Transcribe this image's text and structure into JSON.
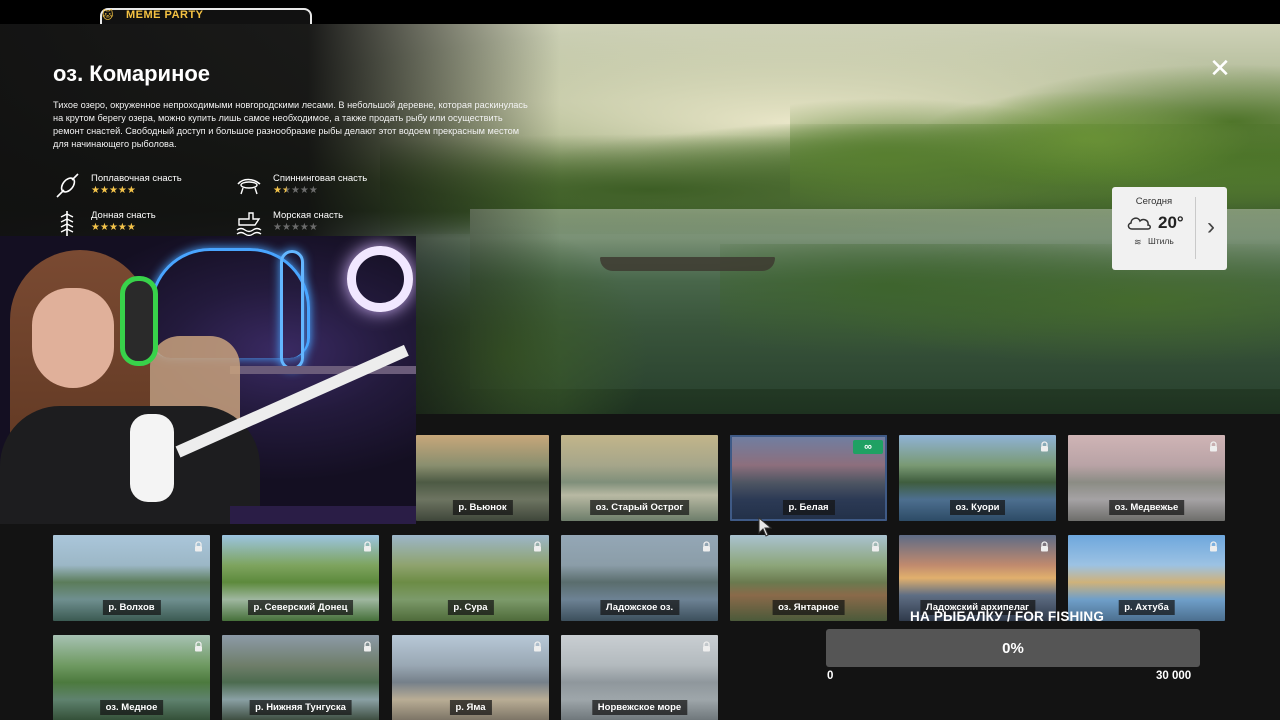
{
  "stream": {
    "badge_text": "MEME PARTY"
  },
  "lake": {
    "title": "оз. Комариное",
    "description": "Тихое озеро, окруженное непроходимыми новгородскими лесами. В небольшой деревне, которая раскинулась на крутом берегу озера, можно купить лишь самое необходимое, а также продать рыбу или осуществить ремонт снастей. Свободный доступ и большое разнообразие рыбы делают этот водоем прекрасным местом для начинающего рыболова.",
    "tackle": [
      {
        "label": "Поплавочная снасть",
        "icon": "float-rod-icon",
        "rating": 5,
        "max": 5
      },
      {
        "label": "Спиннинговая снасть",
        "icon": "spinning-rod-icon",
        "rating": 1.5,
        "max": 5
      },
      {
        "label": "Донная снасть",
        "icon": "bottom-rod-icon",
        "rating": 5,
        "max": 5
      },
      {
        "label": "Морская снасть",
        "icon": "sea-rod-icon",
        "rating": 0,
        "max": 5
      }
    ]
  },
  "weather": {
    "day": "Сегодня",
    "icon": "cloud-icon",
    "temperature": "20°",
    "wind": "Штиль",
    "wind_icon": "wind-icon",
    "next_icon": "chevron-right-icon"
  },
  "close_icon": "close-icon",
  "locations": [
    {
      "name": "р. Вьюнок",
      "locked": false,
      "bg": "linear-gradient(180deg,#c7a77a 0%,#8a8f6f 35%,#4d5a44 55%,#6d7461 75%,#3f463a 100%)"
    },
    {
      "name": "оз. Старый Острог",
      "locked": false,
      "bg": "linear-gradient(180deg,#c2b58a 0%,#a6a68a 35%,#7f8f7a 55%,#b8b9a3 70%,#6d7d6a 100%)"
    },
    {
      "name": "р. Белая",
      "locked": false,
      "badge": "∞",
      "active": true,
      "bg": "linear-gradient(180deg,#6e7fa3 0%,#8d6f7d 35%,#4f5663 55%,#2c3a55 75%,#223048 100%)"
    },
    {
      "name": "оз. Куори",
      "locked": true,
      "bg": "linear-gradient(180deg,#8fb2d6 0%,#7a9a74 35%,#3f5d3e 55%,#4d6f8f 75%,#2d4b66 100%)"
    },
    {
      "name": "оз. Медвежье",
      "locked": true,
      "bg": "linear-gradient(180deg,#cfb4b5 0%,#b9a3a6 35%,#8b8c84 55%,#a5a2a4 75%,#6d6d6a 100%)"
    },
    {
      "name": "р. Волхов",
      "locked": true,
      "bg": "linear-gradient(180deg,#aac6da 0%,#9cb7c6 35%,#5b7c5a 55%,#6f8f8f 75%,#3b5a52 100%)"
    },
    {
      "name": "р. Северский Донец",
      "locked": true,
      "bg": "linear-gradient(180deg,#9cc4e1 0%,#7ea45f 35%,#5d8a3c 55%,#9fb7a0 75%,#46703a 100%)"
    },
    {
      "name": "р. Сура",
      "locked": true,
      "bg": "linear-gradient(180deg,#9cb6c9 0%,#8fa36e 35%,#6c8c45 55%,#7c9a6a 75%,#4f6b3a 100%)"
    },
    {
      "name": "Ладожское оз.",
      "locked": true,
      "bg": "linear-gradient(180deg,#94a7b6 0%,#8b9da8 35%,#5a6d6d 55%,#6d8294 75%,#3c4f5c 100%)"
    },
    {
      "name": "оз. Янтарное",
      "locked": true,
      "bg": "linear-gradient(180deg,#a9c2d0 0%,#8da67a 35%,#6a7a4f 55%,#8a6a4a 70%,#4b5a3a 100%)"
    },
    {
      "name": "Ладожский архипелаг",
      "locked": true,
      "bg": "linear-gradient(180deg,#5e6b86 0%,#c08a6e 35%,#e1b06d 50%,#5f6e84 70%,#2f3a4b 100%)"
    },
    {
      "name": "р. Ахтуба",
      "locked": true,
      "bg": "linear-gradient(180deg,#6ea7dd 0%,#9cc2e3 35%,#cfb27a 55%,#6f9fc9 75%,#4c6f8f 100%)"
    },
    {
      "name": "оз. Медное",
      "locked": true,
      "bg": "linear-gradient(180deg,#a7c2b3 0%,#6f9a62 35%,#4c7a3e 55%,#5f826e 75%,#324e36 100%)"
    },
    {
      "name": "р. Нижняя Тунгуска",
      "locked": true,
      "bg": "linear-gradient(180deg,#8c9aa7 0%,#6f7e6a 35%,#4c6b4f 55%,#8aa0a4 75%,#3a4a3c 100%)"
    },
    {
      "name": "р. Яма",
      "locked": true,
      "bg": "linear-gradient(180deg,#b7c8d7 0%,#9aa8b4 35%,#75808a 55%,#b9ad95 75%,#7a7264 100%)"
    },
    {
      "name": "Норвежское море",
      "locked": true,
      "bg": "linear-gradient(180deg,#c9ced2 0%,#b3babe 35%,#8f979c 55%,#9ea6aa 75%,#6d7579 100%)"
    }
  ],
  "fishing_goal": {
    "title": "НА РЫБАЛКУ / FOR FISHING",
    "percent_text": "0%",
    "progress": 0,
    "min": "0",
    "max": "30 000",
    "fill_color": "#7ac943"
  }
}
